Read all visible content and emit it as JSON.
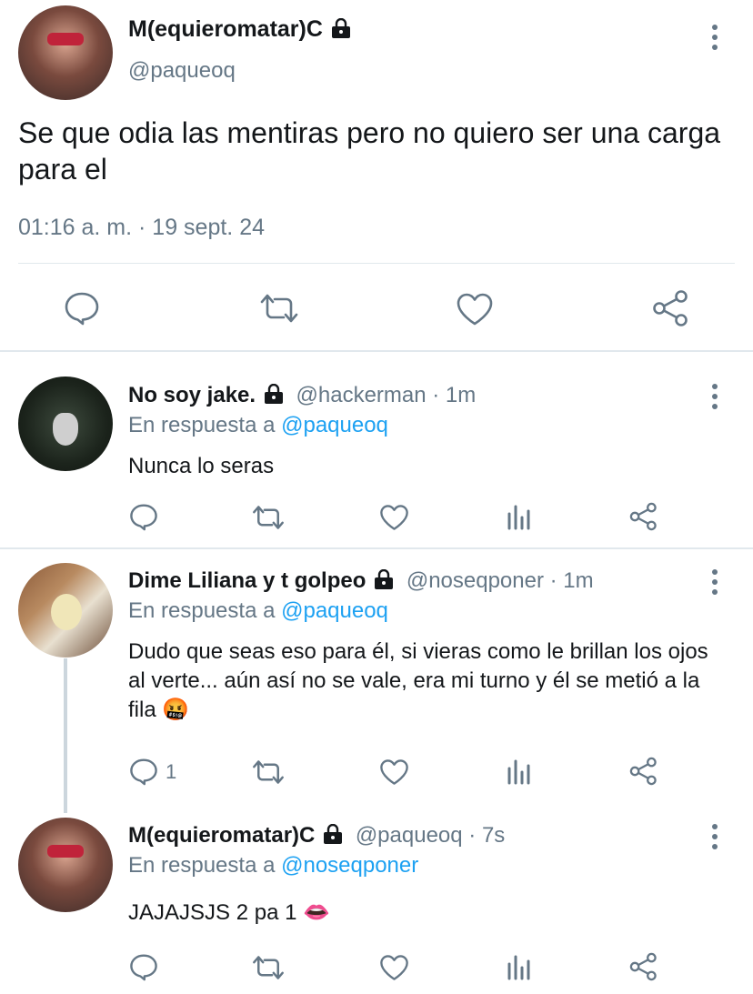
{
  "main_tweet": {
    "name": "M(equieromatar)C",
    "handle": "@paqueoq",
    "text": "Se que odia las mentiras pero no quiero ser una carga para el",
    "timestamp": "01:16 a. m. · 19 sept. 24",
    "icons": [
      "reply-icon",
      "retweet-icon",
      "like-icon",
      "share-icon"
    ]
  },
  "replies": [
    {
      "name": "No soy jake.",
      "handle": "@hackerman · 1m",
      "reply_prefix": "En respuesta a",
      "reply_to": "@paqueoq",
      "text": "Nunca lo seras",
      "reply_count": ""
    },
    {
      "name": "Dime Liliana y t golpeo",
      "handle": "@noseqponer · 1m",
      "reply_prefix": "En respuesta a",
      "reply_to": "@paqueoq",
      "text": "Dudo que seas eso para él, si vieras como le brillan los ojos al verte... aún así no se vale, era mi turno y él se metió a la fila 🤬",
      "reply_count": "1"
    },
    {
      "name": "M(equieromatar)C",
      "handle": "@paqueoq · 7s",
      "reply_prefix": "En respuesta a",
      "reply_to": "@noseqponer",
      "text": "JAJAJSJS 2 pa 1 👄",
      "reply_count": ""
    }
  ],
  "colors": {
    "text": "#14171a",
    "secondary": "#657786",
    "link": "#1da1f2",
    "divider": "#e1e8ed"
  }
}
